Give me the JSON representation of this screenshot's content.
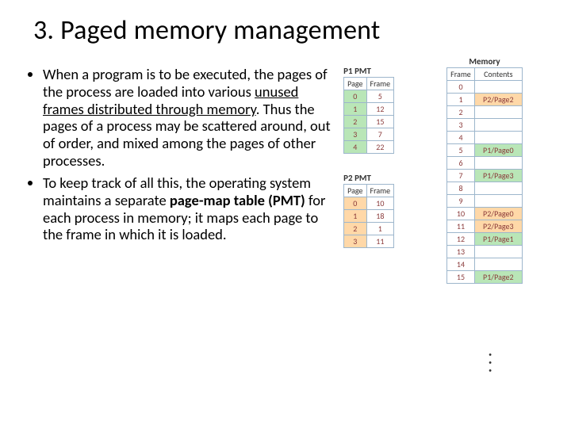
{
  "title": "3. Paged memory management",
  "bullets": {
    "b1_pre": "When a program is to be executed, the pages of the process are loaded into various ",
    "b1_u": "unused frames distributed through memory",
    "b1_post": ". Thus the pages of a process may be scattered around, out of order, and mixed among the pages of other processes.",
    "b2_pre": "To keep track of all this, the operating system maintains a separate  ",
    "b2_bold": "page-map table (PMT)",
    "b2_post": " for each process in memory; it maps each page to the frame in which it is loaded."
  },
  "pmt1": {
    "title": "P1 PMT",
    "h1": "Page",
    "h2": "Frame",
    "rows": [
      {
        "p": "0",
        "f": "5"
      },
      {
        "p": "1",
        "f": "12"
      },
      {
        "p": "2",
        "f": "15"
      },
      {
        "p": "3",
        "f": "7"
      },
      {
        "p": "4",
        "f": "22"
      }
    ]
  },
  "pmt2": {
    "title": "P2 PMT",
    "h1": "Page",
    "h2": "Frame",
    "rows": [
      {
        "p": "0",
        "f": "10"
      },
      {
        "p": "1",
        "f": "18"
      },
      {
        "p": "2",
        "f": "1"
      },
      {
        "p": "3",
        "f": "11"
      }
    ]
  },
  "memory": {
    "title": "Memory",
    "h1": "Frame",
    "h2": "Contents",
    "rows": [
      {
        "f": "0",
        "c": "",
        "cls": ""
      },
      {
        "f": "1",
        "c": "P2/Page2",
        "cls": "p2h"
      },
      {
        "f": "2",
        "c": "",
        "cls": ""
      },
      {
        "f": "3",
        "c": "",
        "cls": ""
      },
      {
        "f": "4",
        "c": "",
        "cls": ""
      },
      {
        "f": "5",
        "c": "P1/Page0",
        "cls": "p1h"
      },
      {
        "f": "6",
        "c": "",
        "cls": ""
      },
      {
        "f": "7",
        "c": "P1/Page3",
        "cls": "p1h"
      },
      {
        "f": "8",
        "c": "",
        "cls": ""
      },
      {
        "f": "9",
        "c": "",
        "cls": ""
      },
      {
        "f": "10",
        "c": "P2/Page0",
        "cls": "p2h"
      },
      {
        "f": "11",
        "c": "P2/Page3",
        "cls": "p2h"
      },
      {
        "f": "12",
        "c": "P1/Page1",
        "cls": "p1h"
      },
      {
        "f": "13",
        "c": "",
        "cls": ""
      },
      {
        "f": "14",
        "c": "",
        "cls": ""
      },
      {
        "f": "15",
        "c": "P1/Page2",
        "cls": "p1h"
      }
    ]
  },
  "chart_data": {
    "type": "table",
    "title": "Paged memory management — Page-Map Tables and Memory Frames",
    "p1_pmt": {
      "page": [
        0,
        1,
        2,
        3,
        4
      ],
      "frame": [
        5,
        12,
        15,
        7,
        22
      ]
    },
    "p2_pmt": {
      "page": [
        0,
        1,
        2,
        3
      ],
      "frame": [
        10,
        18,
        1,
        11
      ]
    },
    "memory_frames": [
      {
        "frame": 0,
        "contents": null
      },
      {
        "frame": 1,
        "contents": "P2/Page2"
      },
      {
        "frame": 2,
        "contents": null
      },
      {
        "frame": 3,
        "contents": null
      },
      {
        "frame": 4,
        "contents": null
      },
      {
        "frame": 5,
        "contents": "P1/Page0"
      },
      {
        "frame": 6,
        "contents": null
      },
      {
        "frame": 7,
        "contents": "P1/Page3"
      },
      {
        "frame": 8,
        "contents": null
      },
      {
        "frame": 9,
        "contents": null
      },
      {
        "frame": 10,
        "contents": "P2/Page0"
      },
      {
        "frame": 11,
        "contents": "P2/Page3"
      },
      {
        "frame": 12,
        "contents": "P1/Page1"
      },
      {
        "frame": 13,
        "contents": null
      },
      {
        "frame": 14,
        "contents": null
      },
      {
        "frame": 15,
        "contents": "P1/Page2"
      }
    ]
  }
}
